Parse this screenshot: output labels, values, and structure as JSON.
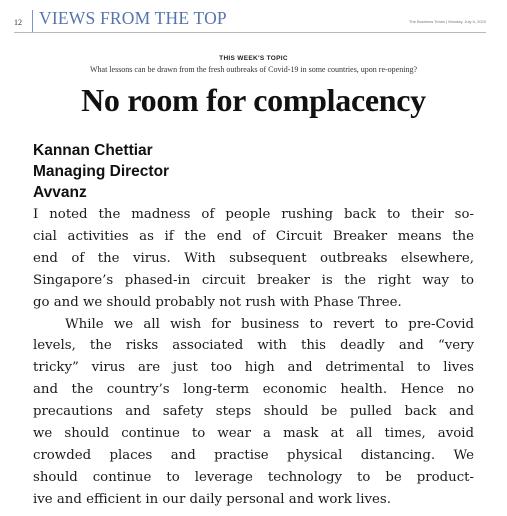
{
  "header": {
    "page_number": "12",
    "section_title": "VIEWS FROM THE TOP",
    "masthead": "The Business Times | Monday, July 6, 2020"
  },
  "topic": {
    "label": "THIS WEEK'S TOPIC",
    "question": "What lessons can be drawn from the fresh outbreaks of Covid-19 in some countries, upon re-opening?"
  },
  "headline": "No room for complacency",
  "byline": {
    "name": "Kannan Chettiar",
    "role": "Managing Director",
    "company": "Avvanz"
  },
  "body": {
    "paragraph_1_lines": [
      "I noted the madness of people rushing back to their so-",
      "cial activities as if the end of Circuit Breaker means the",
      "end of the virus. With subsequent outbreaks elsewhere,",
      "Singapore’s phased-in circuit breaker is the right way to",
      "go and we should probably not rush with Phase Three."
    ],
    "paragraph_2_lines": [
      "While we all wish for business to revert to pre-Covid",
      "levels, the risks associated with this deadly and “very",
      "tricky” virus are just too high and detrimental to lives",
      "and the country’s long-term economic health. Hence no",
      "precautions and safety steps should be pulled back and",
      "we should continue to wear a mask at all times, avoid",
      "crowded places and practise physical distancing. We",
      "should continue to leverage technology to be product-",
      "ive and efficient in our daily personal and work lives."
    ]
  },
  "colors": {
    "section_title": "#5574ae",
    "text": "#1a1a1a"
  }
}
